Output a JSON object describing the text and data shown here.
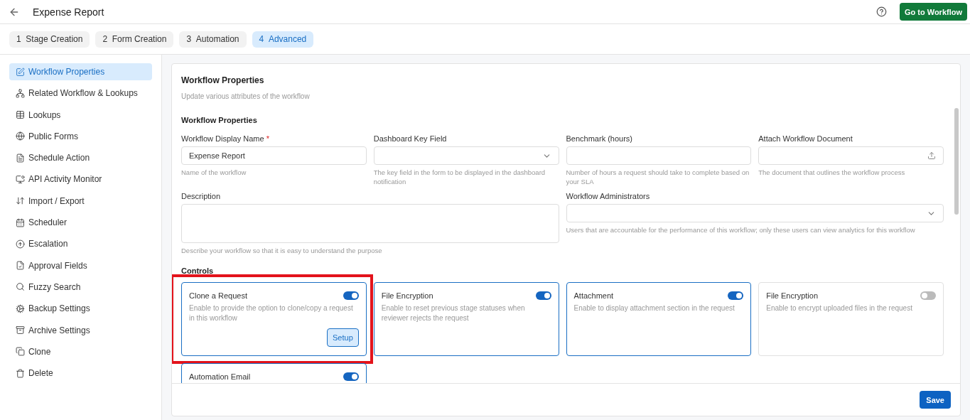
{
  "header": {
    "title": "Expense Report",
    "action": "Go to Workflow"
  },
  "steps": [
    {
      "number": "1",
      "label": "Stage Creation",
      "selected": false
    },
    {
      "number": "2",
      "label": "Form Creation",
      "selected": false
    },
    {
      "number": "3",
      "label": "Automation",
      "selected": false
    },
    {
      "number": "4",
      "label": "Advanced",
      "selected": true
    }
  ],
  "sidebar": {
    "items": [
      {
        "kind": "edit",
        "label": "Workflow Properties",
        "selected": true
      },
      {
        "kind": "network",
        "label": "Related Workflow & Lookups",
        "selected": false
      },
      {
        "kind": "table",
        "label": "Lookups",
        "selected": false
      },
      {
        "kind": "globe",
        "label": "Public Forms",
        "selected": false
      },
      {
        "kind": "doc",
        "label": "Schedule Action",
        "selected": false
      },
      {
        "kind": "monitor",
        "label": "API Activity Monitor",
        "selected": false
      },
      {
        "kind": "swap",
        "label": "Import / Export",
        "selected": false
      },
      {
        "kind": "calendar",
        "label": "Scheduler",
        "selected": false
      },
      {
        "kind": "upcircle",
        "label": "Escalation",
        "selected": false
      },
      {
        "kind": "filecheck",
        "label": "Approval Fields",
        "selected": false
      },
      {
        "kind": "search",
        "label": "Fuzzy Search",
        "selected": false
      },
      {
        "kind": "cog",
        "label": "Backup Settings",
        "selected": false
      },
      {
        "kind": "archive",
        "label": "Archive Settings",
        "selected": false
      },
      {
        "kind": "copy",
        "label": "Clone",
        "selected": false
      },
      {
        "kind": "trash",
        "label": "Delete",
        "selected": false
      }
    ]
  },
  "panel": {
    "title": "Workflow Properties",
    "subtitle": "Update various attributes of the workflow",
    "section": "Workflow Properties",
    "fields": [
      {
        "kind": "text",
        "label": "Workflow Display Name",
        "required_mark": "*",
        "value": "Expense Report",
        "hint": "Name of the workflow"
      },
      {
        "kind": "select",
        "label": "Dashboard Key Field",
        "hint": "The key field in the form to be displayed in the dashboard notification"
      },
      {
        "kind": "text",
        "label": "Benchmark (hours)",
        "hint": "Number of hours a request should take to complete based on your SLA"
      },
      {
        "kind": "upload",
        "label": "Attach Workflow Document",
        "hint": "The document that outlines the workflow process"
      },
      {
        "kind": "textarea",
        "label": "Description",
        "hint": "Describe your workflow so that it is easy to understand the purpose"
      },
      {
        "kind": "select",
        "label": "Workflow Administrators",
        "hint": "Users that are accountable for the performance of this workflow; only these users can view analytics for this workflow"
      }
    ],
    "controls_title": "Controls",
    "controls": [
      {
        "title": "Clone a Request",
        "description": "Enable to provide the option to clone/copy a request in this workflow",
        "on": true,
        "button": "Setup",
        "highlighted": true
      },
      {
        "title": "File Encryption",
        "description": "Enable to reset previous stage statuses when reviewer rejects the request",
        "on": true,
        "highlighted": false
      },
      {
        "title": "Attachment",
        "description": "Enable to display attachment section in the request",
        "on": true,
        "highlighted": false
      },
      {
        "title": "File Encryption",
        "description": "Enable to encrypt uploaded files in the request",
        "on": false,
        "highlighted": false
      },
      {
        "title": "Automation Email",
        "on": true,
        "highlighted": false
      }
    ],
    "save": "Save"
  }
}
